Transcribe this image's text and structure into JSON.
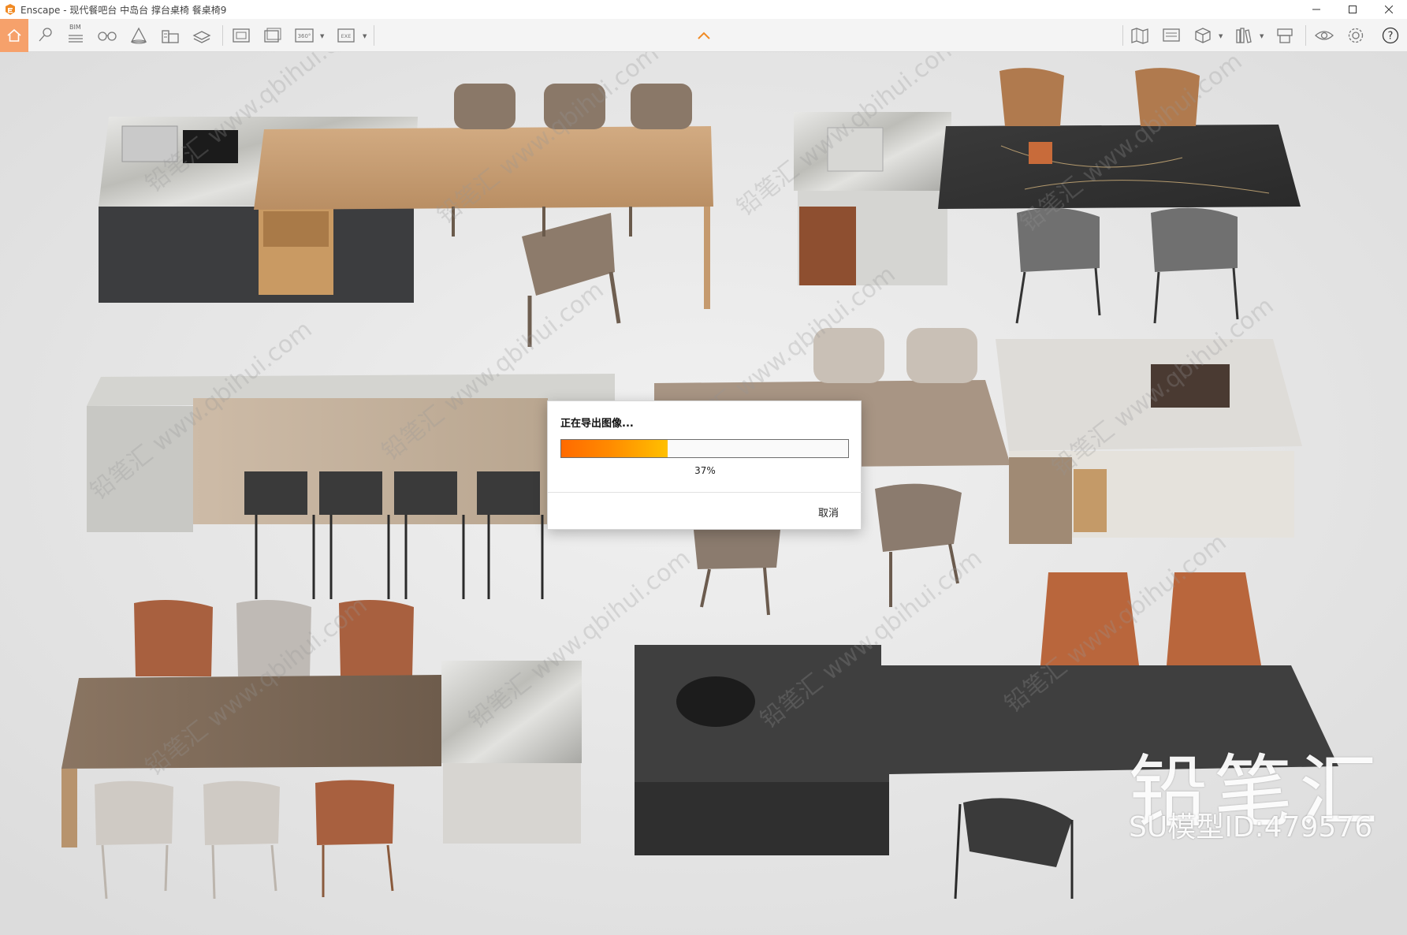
{
  "window": {
    "title": "Enscape - 现代餐吧台 中岛台 撑台桌椅 餐桌椅9",
    "controls": [
      "minimize-icon",
      "maximize-icon",
      "close-icon"
    ]
  },
  "toolbar": {
    "bim_label": "BIM",
    "left_tools": [
      "home-icon",
      "pin-icon",
      "list-icon",
      "binoculars-icon",
      "cone-icon",
      "building-icon",
      "layers-icon",
      "screenshot-icon",
      "batch-render-icon",
      "panorama-360-icon",
      "export-exe-icon"
    ],
    "right_tools": [
      "map-icon",
      "monitor-icon",
      "cube-icon",
      "books-icon",
      "box-stack-icon",
      "eye-icon",
      "settings-icon",
      "help-icon"
    ],
    "panorama_label": "360°",
    "exe_label": "EXE",
    "help_label": "?"
  },
  "dialog": {
    "title": "正在导出图像...",
    "progress": 0.37,
    "percent_text": "37%",
    "cancel_label": "取消"
  },
  "watermark": {
    "brand": "铅笔汇",
    "model_id": "SU模型ID:479576",
    "diagonal_text": "铅笔汇 www.qbihui.com"
  },
  "colors": {
    "accent": "#f6a16b",
    "progress_start": "#ff6a00",
    "progress_end": "#ffc000"
  }
}
